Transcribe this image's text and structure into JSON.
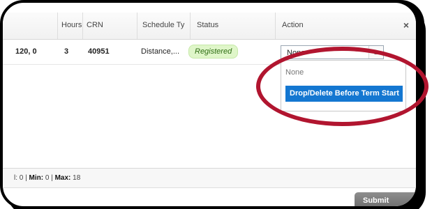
{
  "table": {
    "headers": {
      "hours": "Hours",
      "crn": "CRN",
      "schedule_type": "Schedule Ty",
      "status": "Status",
      "action": "Action"
    },
    "row": {
      "dates": "120, 0",
      "hours": "3",
      "crn": "40951",
      "schedule_type": "Distance,...",
      "status": "Registered"
    }
  },
  "action_select": {
    "selected": "None",
    "options": [
      "None",
      "Drop/Delete Before Term Start"
    ],
    "highlighted": "Drop/Delete Before Term Start"
  },
  "footer": {
    "summary_prefix": "l: 0",
    "min_label": "Min:",
    "min_value": "0",
    "max_label": "Max:",
    "max_value": "18"
  },
  "buttons": {
    "submit": "Submit"
  },
  "colors": {
    "status_bg": "#dff6c9",
    "status_text": "#2f6e14",
    "highlight": "#1477d1",
    "annotation": "#b1152f"
  }
}
